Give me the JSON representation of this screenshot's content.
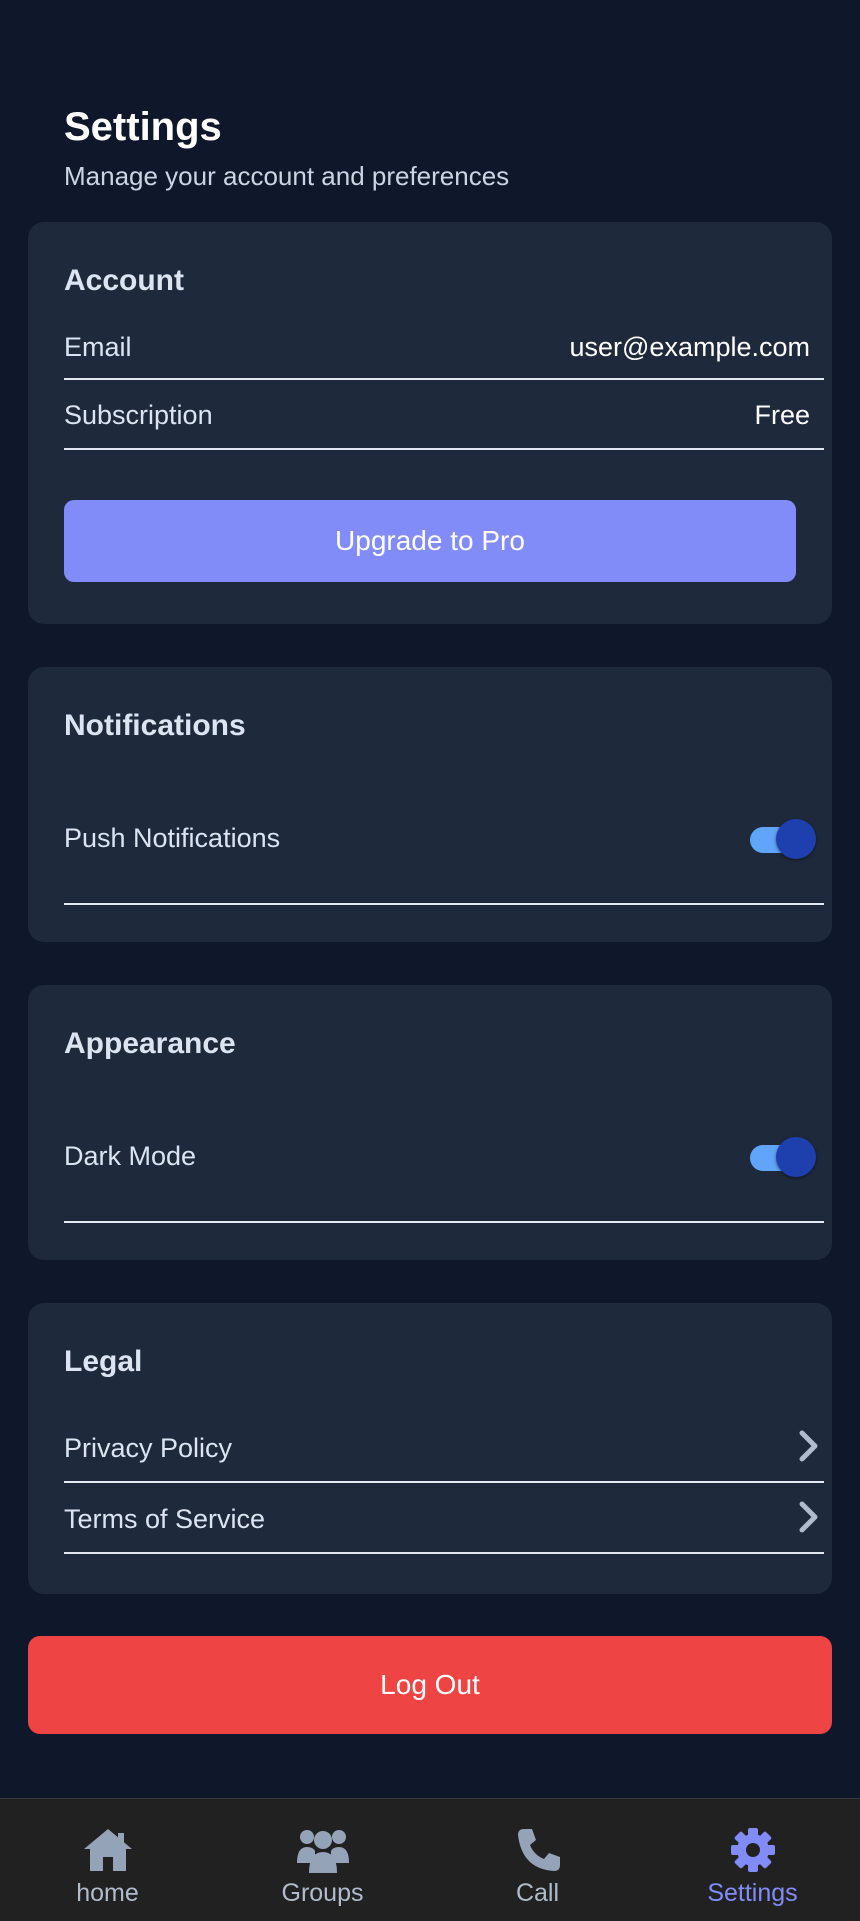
{
  "header": {
    "title": "Settings",
    "subtitle": "Manage your account and preferences"
  },
  "account": {
    "title": "Account",
    "email_label": "Email",
    "email_value": "user@example.com",
    "subscription_label": "Subscription",
    "subscription_value": "Free",
    "upgrade_label": "Upgrade to Pro"
  },
  "notifications": {
    "title": "Notifications",
    "push_label": "Push Notifications",
    "push_enabled": true
  },
  "appearance": {
    "title": "Appearance",
    "dark_mode_label": "Dark Mode",
    "dark_mode_enabled": true
  },
  "legal": {
    "title": "Legal",
    "privacy_label": "Privacy Policy",
    "terms_label": "Terms of Service"
  },
  "logout_label": "Log Out",
  "nav": {
    "items": [
      {
        "label": "home",
        "icon": "home-icon",
        "active": false
      },
      {
        "label": "Groups",
        "icon": "groups-icon",
        "active": false
      },
      {
        "label": "Call",
        "icon": "phone-icon",
        "active": false
      },
      {
        "label": "Settings",
        "icon": "gear-icon",
        "active": true
      }
    ]
  },
  "colors": {
    "background": "#0f172a",
    "card": "#1e293b",
    "accent": "#818cf8",
    "danger": "#ef4444",
    "toggle_track": "#60a5fa",
    "toggle_knob": "#1e40af",
    "nav_background": "#212121"
  }
}
